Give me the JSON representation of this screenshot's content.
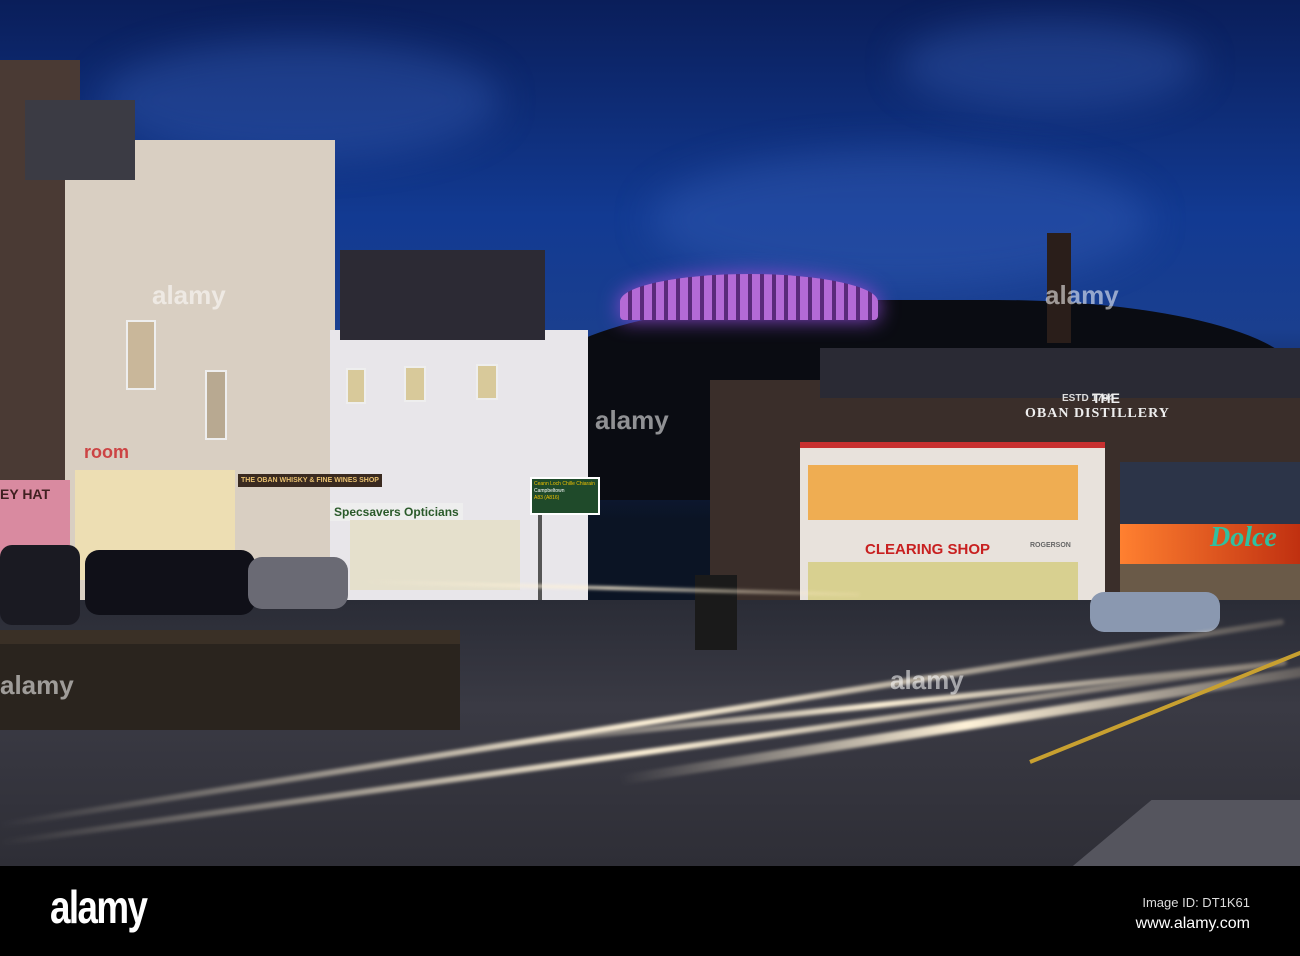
{
  "photo": {
    "signs": {
      "distillery_estd": "ESTD 1794",
      "distillery_the": "THE",
      "distillery_name": "OBAN DISTILLERY",
      "clearing_shop": "CLEARING SHOP",
      "rogerson": "ROGERSON",
      "opticians": "Specsavers Opticians",
      "dolce": "Dolce",
      "room": "room",
      "whisky_shop": "THE OBAN WHISKY & FINE WINES SHOP",
      "hat_shop": "EY HAT",
      "road_sign_line1": "Ceann Loch Chille Chiarain",
      "road_sign_line2": "Campbeltown",
      "road_sign_line3": "A83 (A816)"
    },
    "colors": {
      "sky": "#123a92",
      "colosseum": "#b46ad6",
      "shop_red": "#d23a2a"
    }
  },
  "watermark": {
    "logo": "alamy",
    "image_id": "Image ID: DT1K61",
    "url": "www.alamy.com"
  }
}
